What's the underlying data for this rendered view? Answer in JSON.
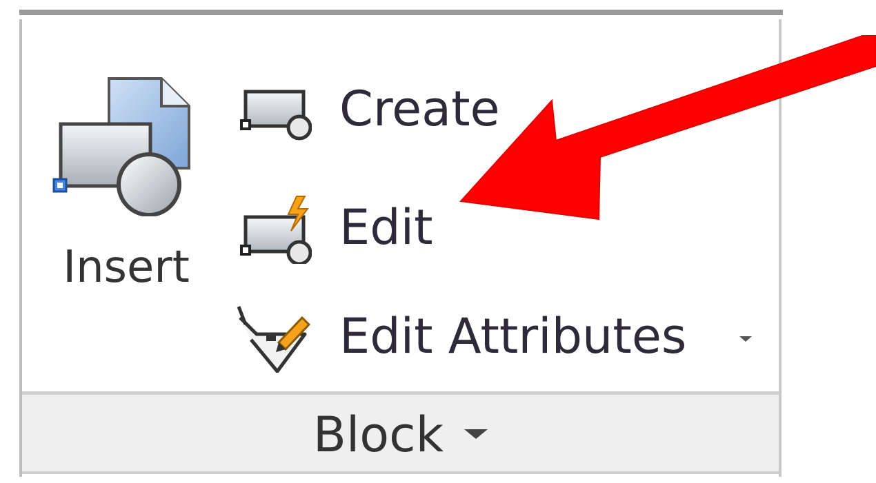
{
  "panel": {
    "title": "Block",
    "buttons": {
      "insert": {
        "label": "Insert",
        "icon": "insert-block-icon"
      },
      "create": {
        "label": "Create",
        "icon": "create-block-icon"
      },
      "edit": {
        "label": "Edit",
        "icon": "edit-block-icon"
      },
      "edit_attributes": {
        "label": "Edit Attributes",
        "icon": "edit-attributes-icon"
      }
    }
  },
  "annotation": {
    "icon": "red-arrow-icon",
    "color": "#ff0000"
  },
  "colors": {
    "text": "#333333",
    "panel_footer": "#efefef",
    "icon_blue": "#8fb3e3",
    "icon_gray": "#d0d4da"
  }
}
